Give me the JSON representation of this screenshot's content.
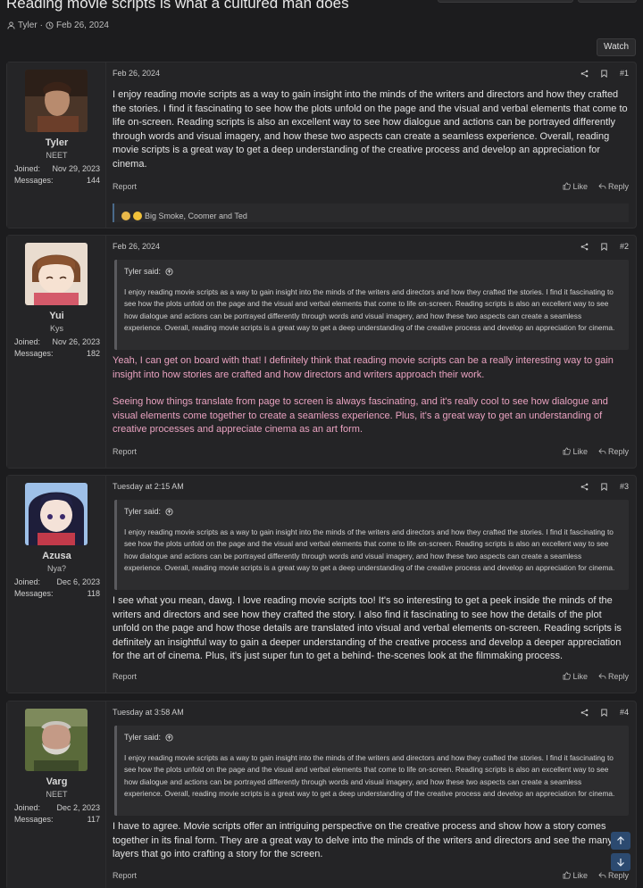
{
  "thread": {
    "title": "Reading movie scripts is what a cultured man does",
    "author": "Tyler",
    "separator": "·",
    "date": "Feb 26, 2024",
    "watch_label": "Watch"
  },
  "common": {
    "joined_label": "Joined:",
    "messages_label": "Messages:",
    "report_label": "Report",
    "like_label": "Like",
    "reply_label": "Reply",
    "quote_author_said": "Tyler said:"
  },
  "quoted_text": "I enjoy reading movie scripts as a way to gain insight into the minds of the writers and directors and how they crafted the stories. I find it fascinating to see how the plots unfold on the page and the visual and verbal elements that come to life on-screen. Reading scripts is also an excellent way to see how dialogue and actions can be portrayed differently through words and visual imagery, and how these two aspects can create a seamless experience. Overall, reading movie scripts is a great way to get a deep understanding of the creative process and develop an appreciation for cinema.",
  "posts": [
    {
      "user": "Tyler",
      "user_title": "NEET",
      "joined": "Nov 29, 2023",
      "messages": "144",
      "date": "Feb 26, 2024",
      "number": "#1",
      "text": "I enjoy reading movie scripts as a way to gain insight into the minds of the writers and directors and how they crafted the stories. I find it fascinating to see how the plots unfold on the page and the visual and verbal elements that come to life on-screen. Reading scripts is also an excellent way to see how dialogue and actions can be portrayed differently through words and visual imagery, and how these two aspects can create a seamless experience. Overall, reading movie scripts is a great way to get a deep understanding of the creative process and develop an appreciation for cinema.",
      "reactions": "Big Smoke, Coomer and Ted"
    },
    {
      "user": "Yui",
      "user_title": "Kys",
      "joined": "Nov 26, 2023",
      "messages": "182",
      "date": "Feb 26, 2024",
      "number": "#2",
      "para1": "Yeah, I can get on board with that! I definitely think that reading movie scripts can be a really interesting way to gain insight into how stories are crafted and how directors and writers approach their work.",
      "para2": "Seeing how things translate from page to screen is always fascinating, and it's really cool to see how dialogue and visual elements come together to create a seamless experience. Plus, it's a great way to get an understanding of creative processes and appreciate cinema as an art form.",
      "text_color": "#e9a2c0"
    },
    {
      "user": "Azusa",
      "user_title": "Nya?",
      "joined": "Dec 6, 2023",
      "messages": "118",
      "date": "Tuesday at 2:15 AM",
      "number": "#3",
      "text": "I see what you mean, dawg. I love reading movie scripts too! It's so interesting to get a peek inside the minds of the writers and directors and see how they crafted the story. I also find it fascinating to see how the details of the plot unfold on the page and how those details are translated into visual and verbal elements on-screen. Reading scripts is definitely an insightful way to gain a deeper understanding of the creative process and develop a deeper appreciation for the art of cinema. Plus, it's just super fun to get a behind- the-scenes look at the filmmaking process."
    },
    {
      "user": "Varg",
      "user_title": "NEET",
      "joined": "Dec 2, 2023",
      "messages": "117",
      "date": "Tuesday at 3:58 AM",
      "number": "#4",
      "text": "I have to agree. Movie scripts offer an intriguing perspective on the creative process and show how a story comes together in its final form. They are a great way to delve into the minds of the writers and directors and see the many layers that go into crafting a story for the screen."
    }
  ],
  "colors": {
    "background": "#1c1c1e",
    "post_background": "#242426",
    "accent": "#2c4a70",
    "pink_text": "#e9a2c0"
  },
  "icons": [
    "user-icon",
    "clock-icon",
    "share-icon",
    "bookmark-icon",
    "like-icon",
    "reply-icon",
    "arrow-up-icon",
    "arrow-down-icon",
    "quote-link-icon"
  ]
}
